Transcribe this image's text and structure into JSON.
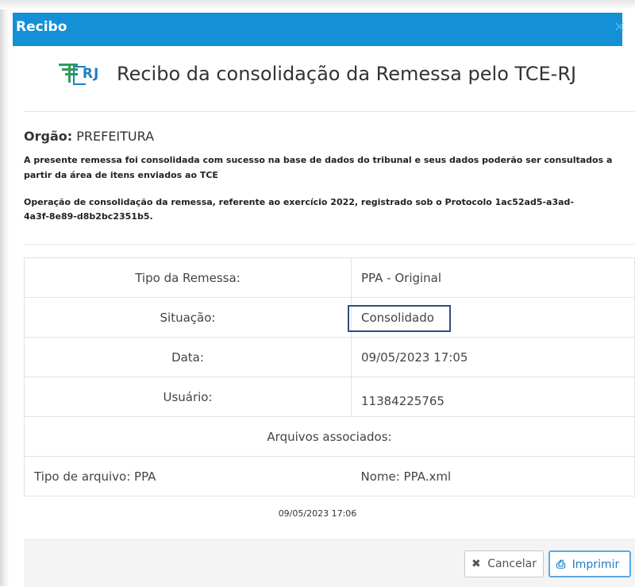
{
  "dialog": {
    "title": "Recibo",
    "close_glyph": "×"
  },
  "brand": {
    "logo_text": "RJ",
    "heading": "Recibo da consolidação da Remessa pelo TCE-RJ"
  },
  "orgao": {
    "label": "Orgão:",
    "value": "PREFEITURA"
  },
  "description": "A presente remessa foi consolidada com sucesso na base de dados do tribunal e seus dados poderão ser consultados a partir da área de itens enviados ao TCE",
  "operation": "Operação de consolidação da remessa, referente ao exercício 2022, registrado sob o Protocolo 1ac52ad5-a3ad-4a3f-8e89-d8b2bc2351b5.",
  "rows": [
    {
      "label": "Tipo da Remessa:",
      "value": "PPA - Original"
    },
    {
      "label": "Situação:",
      "value": "Consolidado"
    },
    {
      "label": "Data:",
      "value": "09/05/2023 17:05"
    },
    {
      "label": "Usuário:",
      "value": "11384225765"
    }
  ],
  "files": {
    "header": "Arquivos associados:",
    "type": "Tipo de arquivo: PPA",
    "name": "Nome: PPA.xml"
  },
  "footer_date": "09/05/2023 17:06",
  "buttons": {
    "cancel_icon": "✖",
    "cancel_label": "Cancelar",
    "print_icon": "⎙",
    "print_label": "Imprimir"
  }
}
